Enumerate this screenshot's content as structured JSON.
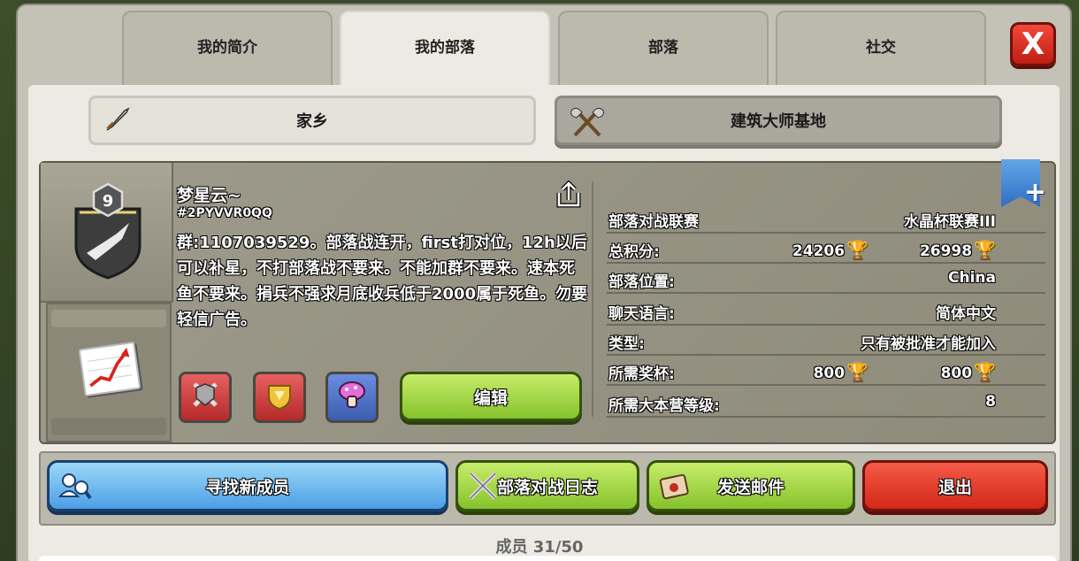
{
  "tabs": [
    {
      "label": "我的简介"
    },
    {
      "label": "我的部落"
    },
    {
      "label": "部落"
    },
    {
      "label": "社交"
    }
  ],
  "close": {
    "label": "X"
  },
  "subtabs": {
    "home": "家乡",
    "builder": "建筑大师基地"
  },
  "clan": {
    "level": "9",
    "name": "梦星云~",
    "tag": "#2PYVVR0QQ",
    "description": "群:1107039529。部落战连开，first打对位，12h以后可以补星，不打部落战不要来。不能加群不要来。速本死鱼不要来。捐兵不强求月底收兵低于2000属于死鱼。勿要轻信广告。"
  },
  "edit_label": "编辑",
  "info": {
    "league_label": "部落对战联赛",
    "league_value": "水晶杯联赛III",
    "points_label": "总积分:",
    "points_home": "24206",
    "points_builder": "26998",
    "location_label": "部落位置:",
    "location_value": "China",
    "language_label": "聊天语言:",
    "language_value": "简体中文",
    "type_label": "类型:",
    "type_value": "只有被批准才能加入",
    "trophies_label": "所需奖杯:",
    "trophies_home": "800",
    "trophies_builder": "800",
    "th_label": "所需大本营等级:",
    "th_value": "8"
  },
  "actions": {
    "find": "寻找新成员",
    "war_log": "部落对战日志",
    "mail": "发送邮件",
    "leave": "退出"
  },
  "members": "成员 31/50",
  "icons": {
    "sword": "sword-icon",
    "axes": "crossed-axes-icon",
    "share": "share-icon",
    "trophy": "trophy-icon",
    "flag": "flag-plus-icon"
  }
}
